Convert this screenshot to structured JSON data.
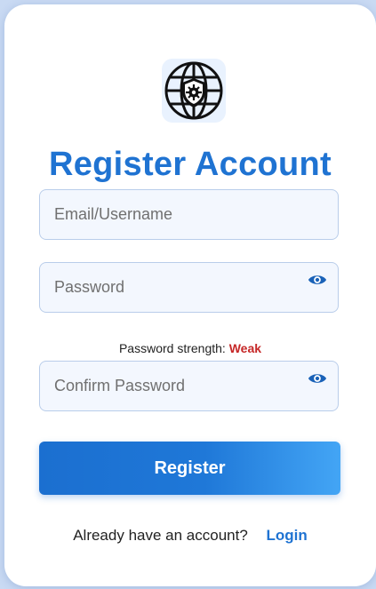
{
  "title": "Register Account",
  "logo": {
    "icon": "globe-shield-gear-icon"
  },
  "form": {
    "email": {
      "placeholder": "Email/Username",
      "value": ""
    },
    "password": {
      "placeholder": "Password",
      "value": "",
      "toggle_icon": "eye-icon"
    },
    "strength": {
      "label": "Password strength:",
      "value": "Weak",
      "value_color": "#c62828"
    },
    "confirm_password": {
      "placeholder": "Confirm Password",
      "value": "",
      "toggle_icon": "eye-icon"
    },
    "submit_label": "Register"
  },
  "footer": {
    "prompt": "Already have an account?",
    "link_label": "Login"
  },
  "colors": {
    "accent": "#1f73d2",
    "background": "#c9daf3"
  }
}
